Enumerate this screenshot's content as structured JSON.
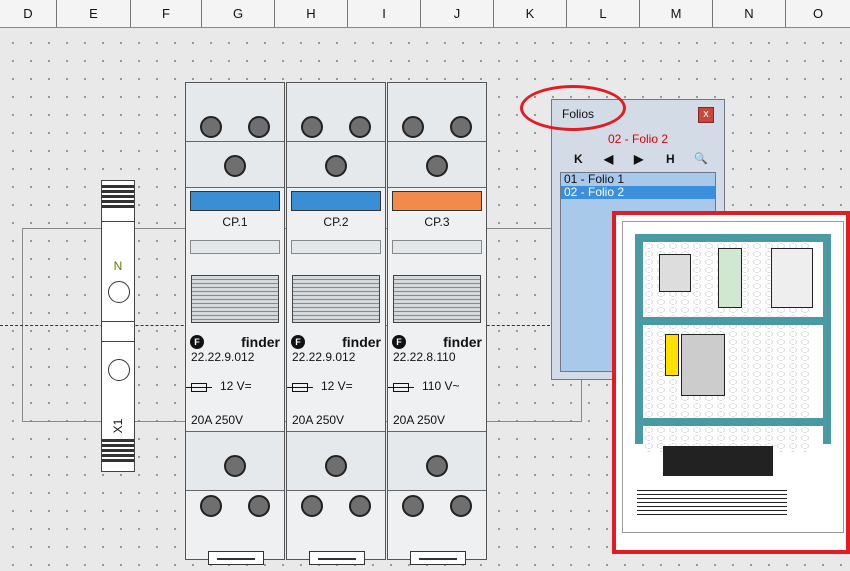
{
  "ruler": {
    "columns": [
      "D",
      "E",
      "F",
      "G",
      "H",
      "I",
      "J",
      "K",
      "L",
      "M",
      "N",
      "O"
    ]
  },
  "terminal": {
    "label_n": "N",
    "label_x": "X1"
  },
  "modules": [
    {
      "cp": "CP.1",
      "brand": "finder",
      "model": "22.22.9.012",
      "voltage": "12 V=",
      "rating": "20A 250V",
      "color": "#3a8fd4"
    },
    {
      "cp": "CP.2",
      "brand": "finder",
      "model": "22.22.9.012",
      "voltage": "12 V=",
      "rating": "20A 250V",
      "color": "#3a8fd4"
    },
    {
      "cp": "CP.3",
      "brand": "finder",
      "model": "22.22.8.110",
      "voltage": "110 V~",
      "rating": "20A 250V",
      "color": "#f28a4b"
    }
  ],
  "folios": {
    "title": "Folios",
    "close": "x",
    "current": "02 - Folio 2",
    "nav": {
      "first": "K",
      "prev": "◀",
      "next": "▶",
      "last": "H",
      "search": "🔍"
    },
    "items": [
      {
        "label": "01 - Folio 1",
        "selected": false
      },
      {
        "label": "02 - Folio 2",
        "selected": true
      }
    ]
  },
  "colors": {
    "highlight": "#e31b23",
    "accent": "#3b8fdc",
    "rail": "#4a9aa3"
  }
}
